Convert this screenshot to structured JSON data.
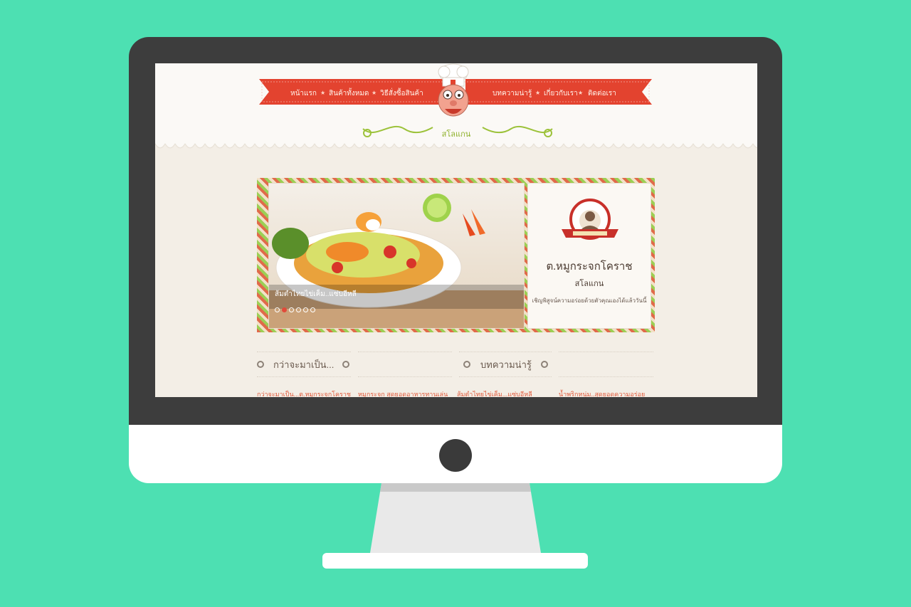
{
  "colors": {
    "background": "#4de0b2",
    "bezel": "#3d3d3d",
    "ribbon": "#e3432f",
    "accent_green": "#8fb12b",
    "link": "#e05a3c"
  },
  "nav": {
    "items": [
      {
        "label": "หน้าแรก",
        "icon": "home"
      },
      {
        "label": "สินค้าทั้งหมด"
      },
      {
        "label": "วิธีสั่งซื้อสินค้า"
      },
      {
        "label": "บทความน่ารู้"
      },
      {
        "label": "เกี่ยวกับเรา"
      },
      {
        "label": "ติดต่อเรา"
      }
    ],
    "separator_icon": "star"
  },
  "header": {
    "slogan": "สโลแกน",
    "mascot_icon": "chef-mascot-icon"
  },
  "hero": {
    "slide_caption": "ส้มตำไทยไข่เค็ม..แซ่บอีหลี",
    "slides_total": 6,
    "active_slide": 2,
    "card": {
      "badge_icon": "chef-badge-logo",
      "title": "ต.หมูกระจกโคราช",
      "slogan": "สโลแกน",
      "description": "เชิญพิสูจน์ความอร่อยด้วยตัวคุณเองได้แล้ววันนี้"
    }
  },
  "sections": {
    "history_title": "กว่าจะมาเป็น...",
    "articles_title": "บทความน่ารู้"
  },
  "articles": [
    "กว่าจะมาเป็น...ต.หมูกระจกโคราช",
    "หมูกระจก สุดยอดอาหารทานเล่น",
    "ส้มตำไทยไข่เค็ม...แซ่บอีหลี",
    "น้ำพริกหนุ่ม..สุดยอดความอร่อย"
  ]
}
